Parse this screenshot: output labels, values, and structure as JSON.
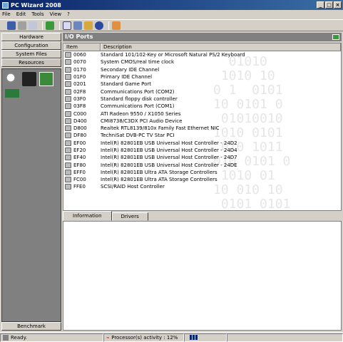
{
  "window": {
    "title": "PC Wizard 2008",
    "buttons": [
      "_",
      "□",
      "×"
    ]
  },
  "menu": [
    "File",
    "Edit",
    "Tools",
    "View",
    "?"
  ],
  "toolbar_icons": [
    "save-icon",
    "print-icon",
    "copy-icon",
    "refresh-icon",
    "search-icon",
    "chip-icon",
    "folder-icon",
    "help-icon",
    "home-icon"
  ],
  "nav": {
    "hardware": "Hardware",
    "configuration": "Configuration",
    "system_files": "System Files",
    "resources": "Resources",
    "benchmark": "Benchmark"
  },
  "main": {
    "title": "I/O Ports"
  },
  "table": {
    "columns": [
      "Item",
      "Description"
    ],
    "rows": [
      [
        "0060",
        "Standard 101/102-Key or Microsoft Natural PS/2 Keyboard"
      ],
      [
        "0070",
        "System CMOS/real time clock"
      ],
      [
        "0170",
        "Secondary IDE Channel"
      ],
      [
        "01F0",
        "Primary IDE Channel"
      ],
      [
        "0201",
        "Standard Game Port"
      ],
      [
        "02F8",
        "Communications Port (COM2)"
      ],
      [
        "03F0",
        "Standard floppy disk controller"
      ],
      [
        "03F8",
        "Communications Port (COM1)"
      ],
      [
        "C000",
        "ATI Radeon 9550 / X1050 Series"
      ],
      [
        "D400",
        "CMI8738/C3DX PCI Audio Device"
      ],
      [
        "D800",
        "Realtek RTL8139/810x Family Fast Ethernet NIC"
      ],
      [
        "DF80",
        "TechniSat DVB-PC TV Star PCI"
      ],
      [
        "EF00",
        "Intel(R) 82801EB USB Universal Host Controller - 24D2"
      ],
      [
        "EF20",
        "Intel(R) 82801EB USB Universal Host Controller - 24D4"
      ],
      [
        "EF40",
        "Intel(R) 82801EB USB Universal Host Controller - 24D7"
      ],
      [
        "EF80",
        "Intel(R) 82801EB USB Universal Host Controller - 24DE"
      ],
      [
        "EFF0",
        "Intel(R) 82801EB Ultra ATA Storage Controllers"
      ],
      [
        "FC00",
        "Intel(R) 82801EB Ultra ATA Storage Controllers"
      ],
      [
        "FFE0",
        "SCSI/RAID Host Controller"
      ]
    ]
  },
  "tabs": [
    "Information",
    "Drivers"
  ],
  "status": {
    "ready": "Ready.",
    "activity": "Processor(s) activity : 12%",
    "activity_level": 0.12
  }
}
